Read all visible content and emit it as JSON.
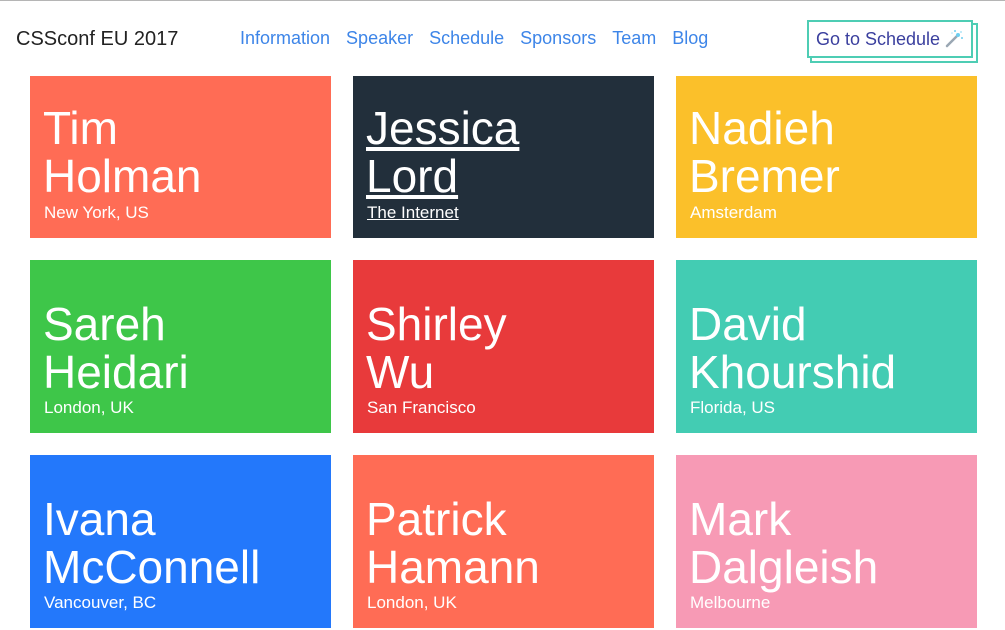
{
  "header": {
    "title": "CSSconf EU 2017",
    "nav": [
      {
        "label": "Information"
      },
      {
        "label": "Speaker"
      },
      {
        "label": "Schedule"
      },
      {
        "label": "Sponsors"
      },
      {
        "label": "Team"
      },
      {
        "label": "Blog"
      }
    ],
    "cta_label": "Go to Schedule",
    "cta_icon": "magic-wand-icon"
  },
  "speakers": [
    {
      "first": "Tim",
      "last": "Holman",
      "location": "New York, US",
      "color": "#ff6c55"
    },
    {
      "first": "Jessica",
      "last": "Lord",
      "location": "The Internet",
      "color": "#222f3b"
    },
    {
      "first": "Nadieh",
      "last": "Bremer",
      "location": "Amsterdam",
      "color": "#fbc02a"
    },
    {
      "first": "Sareh",
      "last": "Heidari",
      "location": "London, UK",
      "color": "#3ec649"
    },
    {
      "first": "Shirley",
      "last": "Wu",
      "location": "San Francisco",
      "color": "#e83a3b"
    },
    {
      "first": "David",
      "last": "Khourshid",
      "location": "Florida, US",
      "color": "#43ccb3"
    },
    {
      "first": "Ivana",
      "last": "McConnell",
      "location": "Vancouver, BC",
      "color": "#2378fb"
    },
    {
      "first": "Patrick",
      "last": "Hamann",
      "location": "London, UK",
      "color": "#ff6c55"
    },
    {
      "first": "Mark",
      "last": "Dalgleish",
      "location": "Melbourne",
      "color": "#f79ab5"
    }
  ]
}
